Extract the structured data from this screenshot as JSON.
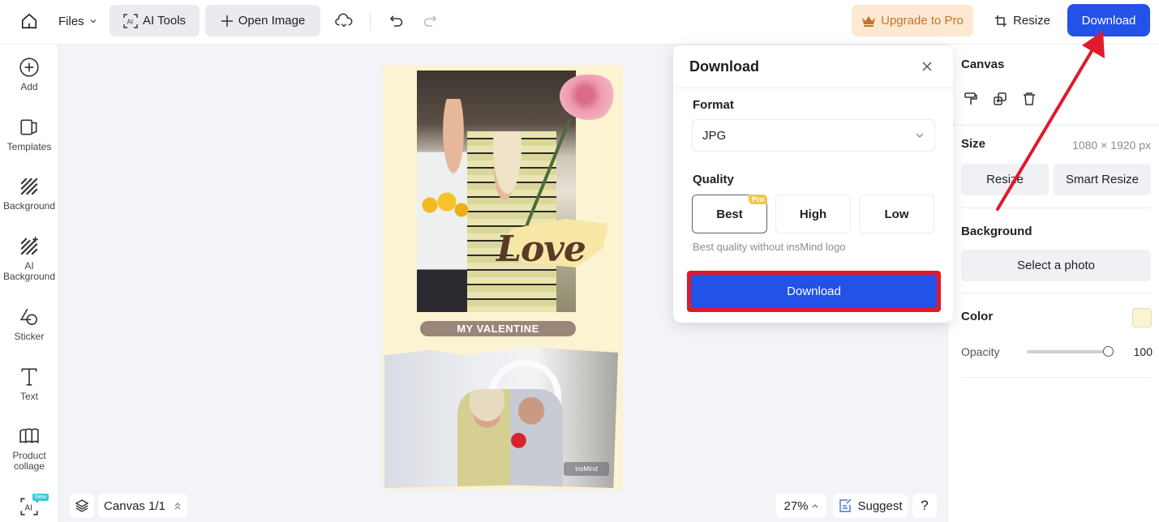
{
  "topbar": {
    "files_label": "Files",
    "ai_tools_label": "AI Tools",
    "open_image_label": "Open Image",
    "upgrade_label": "Upgrade to Pro",
    "resize_label": "Resize",
    "download_label": "Download"
  },
  "sidebar": {
    "items": [
      {
        "label": "Add",
        "icon": "plus-circle-icon"
      },
      {
        "label": "Templates",
        "icon": "templates-icon"
      },
      {
        "label": "Background",
        "icon": "hatch-icon"
      },
      {
        "label": "AI\nBackground",
        "icon": "ai-hatch-icon"
      },
      {
        "label": "Sticker",
        "icon": "sticker-icon"
      },
      {
        "label": "Text",
        "icon": "text-icon"
      },
      {
        "label": "Product\ncollage",
        "icon": "collage-icon"
      },
      {
        "label": "",
        "icon": "ai-scan-icon",
        "badge": "New"
      }
    ]
  },
  "canvas": {
    "love_text": "Love",
    "valentine_text": "MY VALENTINE",
    "watermark_text": "insMind"
  },
  "bottom": {
    "canvas_label": "Canvas 1/1",
    "zoom_label": "27%",
    "suggest_label": "Suggest",
    "help_label": "?"
  },
  "download_dialog": {
    "title": "Download",
    "format_label": "Format",
    "format_value": "JPG",
    "quality_label": "Quality",
    "quality_options": [
      {
        "label": "Best",
        "badge": "Pro",
        "selected": true
      },
      {
        "label": "High",
        "selected": false
      },
      {
        "label": "Low",
        "selected": false
      }
    ],
    "quality_note": "Best quality without insMind logo",
    "download_button": "Download"
  },
  "right_panel": {
    "canvas_heading": "Canvas",
    "size_heading": "Size",
    "size_value": "1080 × 1920 px",
    "resize_button": "Resize",
    "smart_resize_button": "Smart Resize",
    "background_heading": "Background",
    "select_photo_button": "Select a photo",
    "color_heading": "Color",
    "color_value": "#fbf3d1",
    "opacity_label": "Opacity",
    "opacity_value": "100"
  },
  "colors": {
    "accent": "#2252e8",
    "upgrade_bg": "#fde9d2",
    "upgrade_text": "#c8722a",
    "highlight": "#e0192c"
  }
}
